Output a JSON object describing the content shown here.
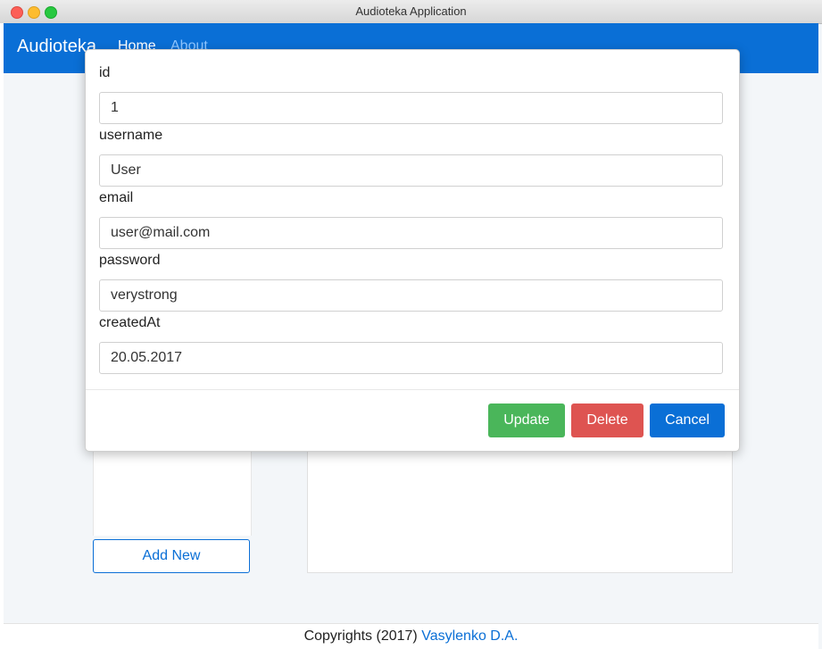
{
  "window": {
    "title": "Audioteka Application"
  },
  "navbar": {
    "brand": "Audioteka",
    "home": "Home",
    "about": "About"
  },
  "sidebar": {
    "add_new_label": "Add New"
  },
  "footer": {
    "prefix": "Copyrights (2017) ",
    "author": "Vasylenko D.A."
  },
  "modal": {
    "fields": [
      {
        "label": "id",
        "value": "1"
      },
      {
        "label": "username",
        "value": "User"
      },
      {
        "label": "email",
        "value": "user@mail.com"
      },
      {
        "label": "password",
        "value": "verystrong"
      },
      {
        "label": "createdAt",
        "value": "20.05.2017"
      }
    ],
    "buttons": {
      "update": "Update",
      "delete": "Delete",
      "cancel": "Cancel"
    }
  },
  "colors": {
    "navbar": "#0a6fd6",
    "update": "#4ab65a",
    "delete": "#de5451",
    "cancel": "#0a6fd6"
  }
}
